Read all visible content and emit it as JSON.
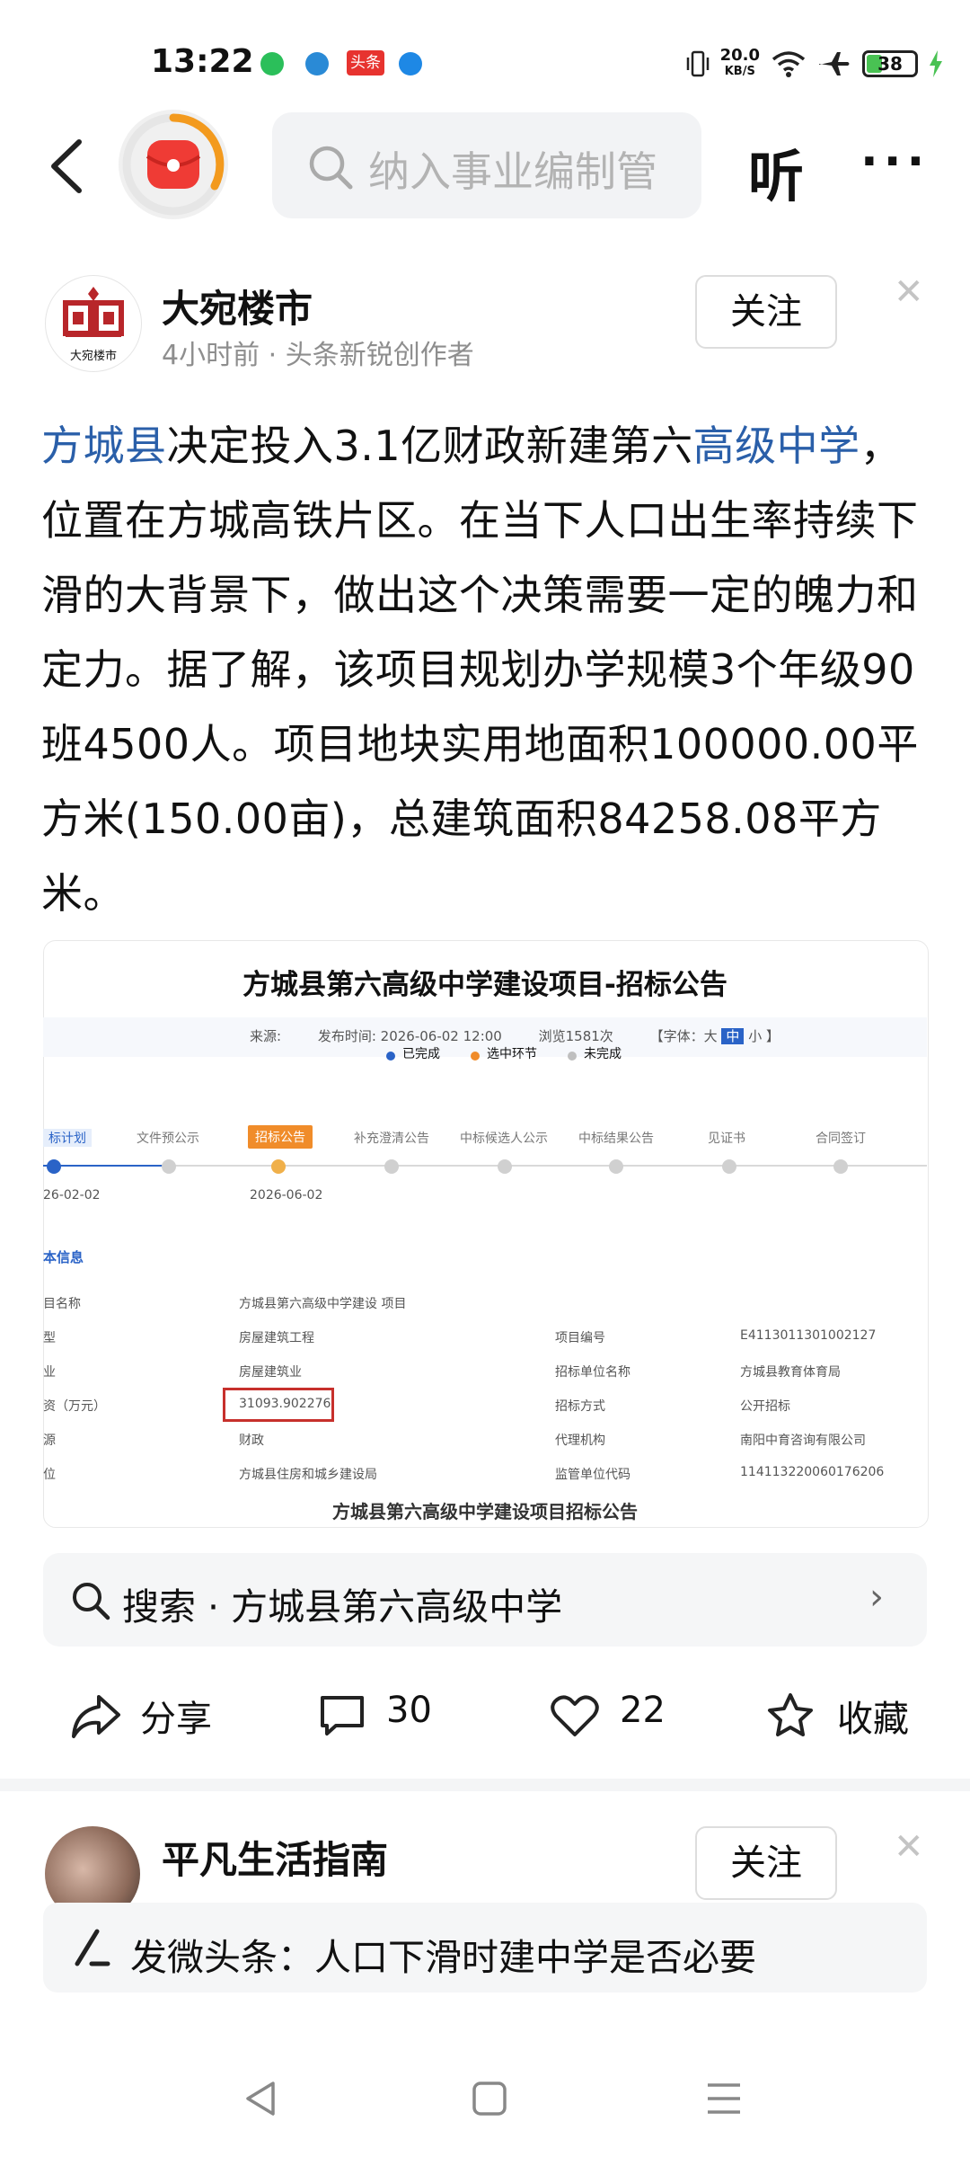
{
  "status_bar": {
    "time": "13:22",
    "toutiao_badge": "头条",
    "net_speed_value": "20.0",
    "net_speed_unit": "KB/S",
    "battery": "38",
    "battery_level": 0.38,
    "battery_color": "#49c253"
  },
  "header": {
    "search_placeholder": "纳入事业编制管",
    "listen_label": "听",
    "more_label": "···"
  },
  "author": {
    "name": "大宛楼市",
    "meta": "4小时前 · 头条新锐创作者",
    "avatar_text": "大宛楼市",
    "follow_label": "关注",
    "close_label": "✕"
  },
  "article": {
    "link1": "方城县",
    "text1": "决定投入3.1亿财政新建第六",
    "link2": "高级中学",
    "text2": "，位置在方城高铁片区。在当下人口出生率持续下滑的大背景下，做出这个决策需要一定的魄力和定力。据了解，该项目规划办学规模3个年级90班4500人。项目地块实用地面积100000.00平方米(150.00亩)，总建筑面积84258.08平方米。",
    "link_color": "#2a5fa9"
  },
  "embed": {
    "title": "方城县第六高级中学建设项目-招标公告",
    "meta_source": "来源:",
    "meta_publish": "发布时间: 2026-06-02 12:00",
    "meta_views": "浏览1581次",
    "meta_font_prefix": "【字体：大",
    "meta_font_mid": "中",
    "meta_font_suffix": "小 】",
    "legend": [
      "已完成",
      "选中环节",
      "未完成"
    ],
    "legend_colors": [
      "#2a63c7",
      "#f08c2a",
      "#bfbfbf"
    ],
    "steps": [
      "标计划",
      "文件预公示",
      "招标公告",
      "补充澄清公告",
      "中标候选人公示",
      "中标结果公告",
      "见证书",
      "合同签订"
    ],
    "step_date_1": "26-02-02",
    "step_date_3": "2026-06-02",
    "section_title": "本信息",
    "rows": [
      {
        "l1": "目名称",
        "v1": "方城县第六高级中学建设 项目",
        "l2": "",
        "v2": ""
      },
      {
        "l1": "型",
        "v1": "房屋建筑工程",
        "l2": "项目编号",
        "v2": "E4113011301002127"
      },
      {
        "l1": "业",
        "v1": "房屋建筑业",
        "l2": "招标单位名称",
        "v2": "方城县教育体育局"
      },
      {
        "l1": "资（万元）",
        "v1": "31093.902276",
        "l2": "招标方式",
        "v2": "公开招标"
      },
      {
        "l1": "源",
        "v1": "财政",
        "l2": "代理机构",
        "v2": "南阳中育咨询有限公司"
      },
      {
        "l1": "位",
        "v1": "方城县住房和城乡建设局",
        "l2": "监管单位代码",
        "v2": "114113220060176206"
      }
    ],
    "caption": "方城县第六高级中学建设项目招标公告"
  },
  "suggest": {
    "text": "搜索 · 方城县第六高级中学",
    "arrow": "›"
  },
  "actions": {
    "share": "分享",
    "comments": "30",
    "likes": "22",
    "collect": "收藏"
  },
  "card2": {
    "name": "平凡生活指南",
    "follow_label": "关注",
    "close_label": "✕"
  },
  "compose": {
    "text": "发微头条：人口下滑时建中学是否必要"
  }
}
